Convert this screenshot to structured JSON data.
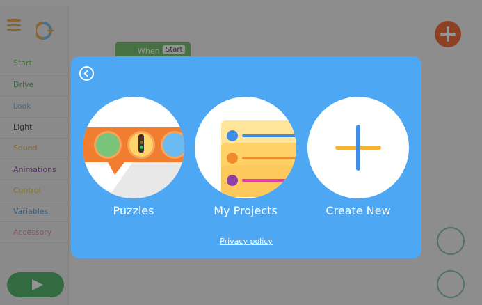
{
  "background": {
    "categories": [
      {
        "label": "Start",
        "color": "#6bbf52"
      },
      {
        "label": "Drive",
        "color": "#44a65a"
      },
      {
        "label": "Look",
        "color": "#6fa7d6"
      },
      {
        "label": "Light",
        "color": "#333333"
      },
      {
        "label": "Sound",
        "color": "#e19a4d"
      },
      {
        "label": "Animations",
        "color": "#8c3fa8"
      },
      {
        "label": "Control",
        "color": "#e2c12c"
      },
      {
        "label": "Variables",
        "color": "#3e8dd6"
      },
      {
        "label": "Accessory",
        "color": "#e77a9b"
      }
    ],
    "block": {
      "label": "When",
      "value": "Start"
    }
  },
  "modal": {
    "options": [
      {
        "label": "Puzzles",
        "icon": "puzzles-icon"
      },
      {
        "label": "My Projects",
        "icon": "projects-icon"
      },
      {
        "label": "Create New",
        "icon": "plus-icon"
      }
    ],
    "privacy_link": "Privacy policy"
  },
  "colors": {
    "modal_background": "#4ea7f2",
    "add_button": "#f15a22",
    "play_button": "#3fae5a"
  }
}
